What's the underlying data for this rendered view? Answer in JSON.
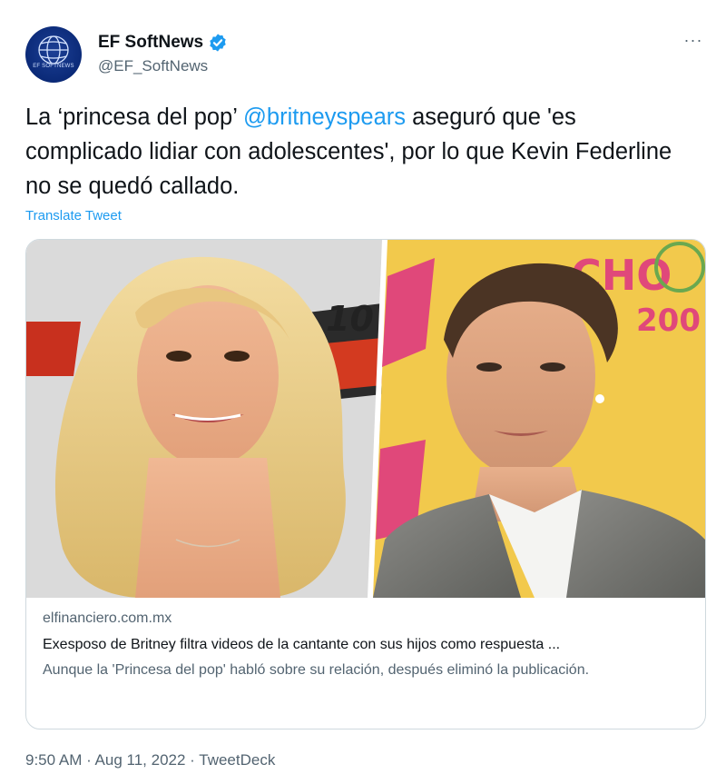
{
  "author": {
    "avatar_text": "EF SOFTNEWS",
    "name": "EF SoftNews",
    "handle": "@EF_SoftNews",
    "verified_icon": "verified-badge-icon",
    "badge_color": "#1d9bf0"
  },
  "menu": {
    "more_icon": "more-horizontal-icon",
    "more_label": "···"
  },
  "tweet": {
    "text_before": "La ‘princesa del pop’ ",
    "mention": "@britneyspears",
    "text_after": " aseguró que 'es complicado lidiar con adolescentes', por lo que Kevin Federline no se quedó callado.",
    "translate_label": "Translate Tweet"
  },
  "card": {
    "image_left_sign_text": "10",
    "image_right_sign_text": "CHO",
    "image_right_year": "200",
    "domain": "elfinanciero.com.mx",
    "title": "Exesposo de Britney filtra videos de la cantante con sus hijos como respuesta ...",
    "description": "Aunque la 'Princesa del pop' habló sobre su relación, después eliminó la publicación."
  },
  "meta": {
    "time": "9:50 AM",
    "separator": " · ",
    "date": "Aug 11, 2022",
    "source": "TweetDeck"
  },
  "colors": {
    "link": "#1d9bf0",
    "muted": "#536471",
    "text": "#0f1419",
    "border": "#cfd9de"
  }
}
